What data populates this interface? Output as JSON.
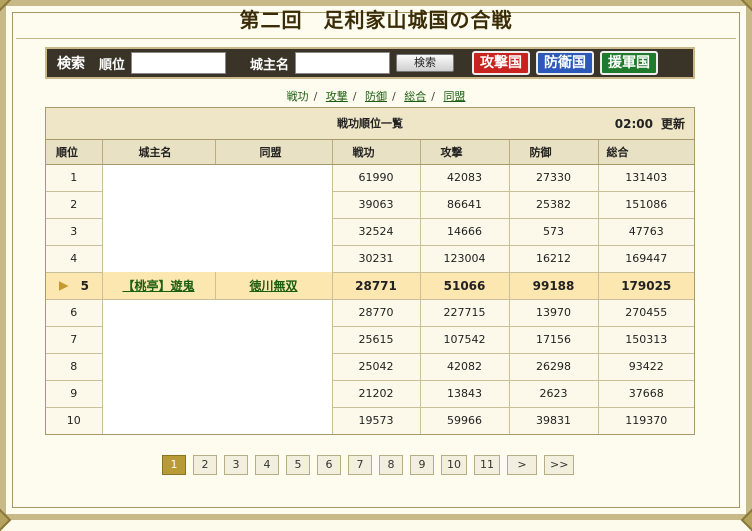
{
  "title": "第二回　足利家山城国の合戦",
  "search": {
    "label": "検索",
    "rank_label": "順位",
    "lord_label": "城主名",
    "button": "検索",
    "rank_value": "",
    "lord_value": ""
  },
  "tabs": [
    "攻撃国",
    "防衛国",
    "援軍国"
  ],
  "subnav": [
    "戦功",
    "攻撃",
    "防御",
    "総合",
    "同盟"
  ],
  "table": {
    "caption": "戦功順位一覧",
    "time": "02:00",
    "update_label": "更新",
    "columns": [
      "順位",
      "城主名",
      "同盟",
      "戦功",
      "攻撃",
      "防御",
      "総合"
    ],
    "rows": [
      {
        "rank": "1",
        "lord": "",
        "alliance": "",
        "merit": "61990",
        "attack": "42083",
        "defense": "27330",
        "total": "131403"
      },
      {
        "rank": "2",
        "lord": "",
        "alliance": "",
        "merit": "39063",
        "attack": "86641",
        "defense": "25382",
        "total": "151086"
      },
      {
        "rank": "3",
        "lord": "",
        "alliance": "",
        "merit": "32524",
        "attack": "14666",
        "defense": "573",
        "total": "47763"
      },
      {
        "rank": "4",
        "lord": "",
        "alliance": "",
        "merit": "30231",
        "attack": "123004",
        "defense": "16212",
        "total": "169447"
      },
      {
        "rank": "5",
        "lord": "【桃亭】遊鬼",
        "alliance": "徳川無双",
        "merit": "28771",
        "attack": "51066",
        "defense": "99188",
        "total": "179025"
      },
      {
        "rank": "6",
        "lord": "",
        "alliance": "",
        "merit": "28770",
        "attack": "227715",
        "defense": "13970",
        "total": "270455"
      },
      {
        "rank": "7",
        "lord": "",
        "alliance": "",
        "merit": "25615",
        "attack": "107542",
        "defense": "17156",
        "total": "150313"
      },
      {
        "rank": "8",
        "lord": "",
        "alliance": "",
        "merit": "25042",
        "attack": "42082",
        "defense": "26298",
        "total": "93422"
      },
      {
        "rank": "9",
        "lord": "",
        "alliance": "",
        "merit": "21202",
        "attack": "13843",
        "defense": "2623",
        "total": "37668"
      },
      {
        "rank": "10",
        "lord": "",
        "alliance": "",
        "merit": "19573",
        "attack": "59966",
        "defense": "39831",
        "total": "119370"
      }
    ]
  },
  "pager": {
    "pages": [
      "1",
      "2",
      "3",
      "4",
      "5",
      "6",
      "7",
      "8",
      "9",
      "10",
      "11"
    ],
    "current": "1",
    "next": ">",
    "last": ">>"
  },
  "colors": {
    "attack_tab": "#c8231e",
    "defense_tab": "#2a59b8",
    "support_tab": "#1f7a2c",
    "highlight_row": "#fce7b0",
    "link": "#1b5e11"
  }
}
